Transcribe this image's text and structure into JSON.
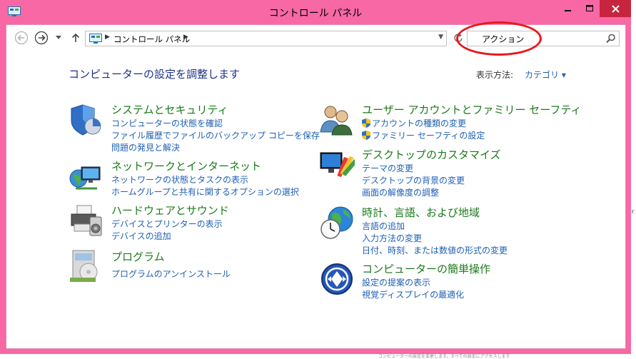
{
  "window": {
    "title": "コントロール パネル",
    "frame_color": "#f768a5",
    "close_color": "#c7253e"
  },
  "nav": {
    "address": "コントロール パネル",
    "search_value": "アクション",
    "annotation_color": "#e8171a"
  },
  "page": {
    "heading": "コンピューターの設定を調整します",
    "view_by_label": "表示方法:",
    "view_by_value": "カテゴリ ▾"
  },
  "categories": [
    {
      "icon": "security-shield-icon",
      "title": "システムとセキュリティ",
      "links": [
        "コンピューターの状態を確認",
        "ファイル履歴でファイルのバックアップ コピーを保存",
        "問題の発見と解決"
      ]
    },
    {
      "icon": "network-globe-icon",
      "title": "ネットワークとインターネット",
      "links": [
        "ネットワークの状態とタスクの表示",
        "ホームグループと共有に関するオプションの選択"
      ]
    },
    {
      "icon": "printer-icon",
      "title": "ハードウェアとサウンド",
      "links": [
        "デバイスとプリンターの表示",
        "デバイスの追加"
      ]
    },
    {
      "icon": "programs-box-icon",
      "title": "プログラム",
      "links": [
        "プログラムのアンインストール"
      ]
    },
    {
      "icon": "users-icon",
      "title": "ユーザー アカウントとファミリー セーフティ",
      "links": [
        "アカウントの種類の変更",
        "ファミリー セーフティの設定"
      ]
    },
    {
      "icon": "desktop-palette-icon",
      "title": "デスクトップのカスタマイズ",
      "links": [
        "テーマの変更",
        "デスクトップの背景の変更",
        "画面の解像度の調整"
      ]
    },
    {
      "icon": "clock-globe-icon",
      "title": "時計、言語、および地域",
      "links": [
        "言語の追加",
        "入力方法の変更",
        "日付、時刻、または数値の形式の変更"
      ]
    },
    {
      "icon": "ease-of-access-icon",
      "title": "コンピューターの簡単操作",
      "links": [
        "設定の提案の表示",
        "視覚ディスプレイの最適化"
      ]
    }
  ],
  "fragments": {
    "bottom_text": "コンピューターの設定を変更します。すべての設定にアクセスします",
    "right_edge": "r"
  }
}
